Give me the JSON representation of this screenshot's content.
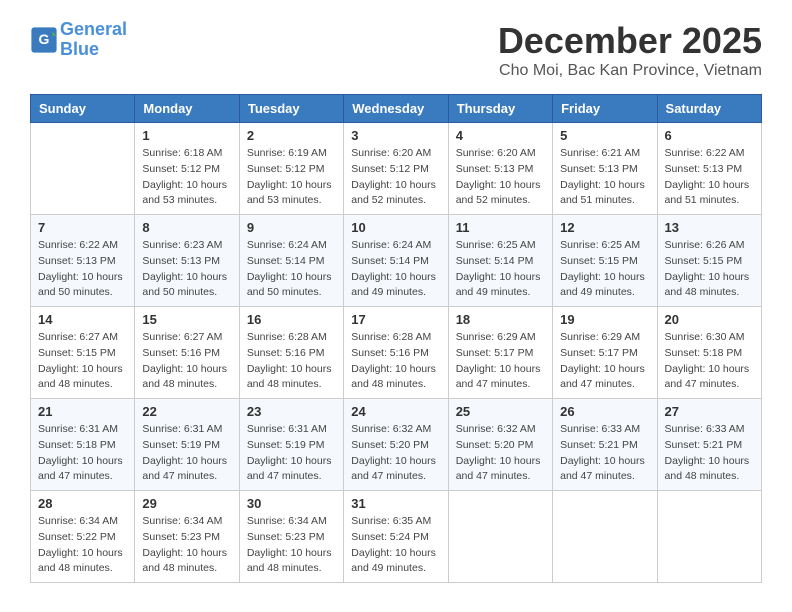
{
  "header": {
    "logo_line1": "General",
    "logo_line2": "Blue",
    "title": "December 2025",
    "subtitle": "Cho Moi, Bac Kan Province, Vietnam"
  },
  "weekdays": [
    "Sunday",
    "Monday",
    "Tuesday",
    "Wednesday",
    "Thursday",
    "Friday",
    "Saturday"
  ],
  "weeks": [
    [
      {
        "day": "",
        "info": ""
      },
      {
        "day": "1",
        "info": "Sunrise: 6:18 AM\nSunset: 5:12 PM\nDaylight: 10 hours\nand 53 minutes."
      },
      {
        "day": "2",
        "info": "Sunrise: 6:19 AM\nSunset: 5:12 PM\nDaylight: 10 hours\nand 53 minutes."
      },
      {
        "day": "3",
        "info": "Sunrise: 6:20 AM\nSunset: 5:12 PM\nDaylight: 10 hours\nand 52 minutes."
      },
      {
        "day": "4",
        "info": "Sunrise: 6:20 AM\nSunset: 5:13 PM\nDaylight: 10 hours\nand 52 minutes."
      },
      {
        "day": "5",
        "info": "Sunrise: 6:21 AM\nSunset: 5:13 PM\nDaylight: 10 hours\nand 51 minutes."
      },
      {
        "day": "6",
        "info": "Sunrise: 6:22 AM\nSunset: 5:13 PM\nDaylight: 10 hours\nand 51 minutes."
      }
    ],
    [
      {
        "day": "7",
        "info": "Sunrise: 6:22 AM\nSunset: 5:13 PM\nDaylight: 10 hours\nand 50 minutes."
      },
      {
        "day": "8",
        "info": "Sunrise: 6:23 AM\nSunset: 5:13 PM\nDaylight: 10 hours\nand 50 minutes."
      },
      {
        "day": "9",
        "info": "Sunrise: 6:24 AM\nSunset: 5:14 PM\nDaylight: 10 hours\nand 50 minutes."
      },
      {
        "day": "10",
        "info": "Sunrise: 6:24 AM\nSunset: 5:14 PM\nDaylight: 10 hours\nand 49 minutes."
      },
      {
        "day": "11",
        "info": "Sunrise: 6:25 AM\nSunset: 5:14 PM\nDaylight: 10 hours\nand 49 minutes."
      },
      {
        "day": "12",
        "info": "Sunrise: 6:25 AM\nSunset: 5:15 PM\nDaylight: 10 hours\nand 49 minutes."
      },
      {
        "day": "13",
        "info": "Sunrise: 6:26 AM\nSunset: 5:15 PM\nDaylight: 10 hours\nand 48 minutes."
      }
    ],
    [
      {
        "day": "14",
        "info": "Sunrise: 6:27 AM\nSunset: 5:15 PM\nDaylight: 10 hours\nand 48 minutes."
      },
      {
        "day": "15",
        "info": "Sunrise: 6:27 AM\nSunset: 5:16 PM\nDaylight: 10 hours\nand 48 minutes."
      },
      {
        "day": "16",
        "info": "Sunrise: 6:28 AM\nSunset: 5:16 PM\nDaylight: 10 hours\nand 48 minutes."
      },
      {
        "day": "17",
        "info": "Sunrise: 6:28 AM\nSunset: 5:16 PM\nDaylight: 10 hours\nand 48 minutes."
      },
      {
        "day": "18",
        "info": "Sunrise: 6:29 AM\nSunset: 5:17 PM\nDaylight: 10 hours\nand 47 minutes."
      },
      {
        "day": "19",
        "info": "Sunrise: 6:29 AM\nSunset: 5:17 PM\nDaylight: 10 hours\nand 47 minutes."
      },
      {
        "day": "20",
        "info": "Sunrise: 6:30 AM\nSunset: 5:18 PM\nDaylight: 10 hours\nand 47 minutes."
      }
    ],
    [
      {
        "day": "21",
        "info": "Sunrise: 6:31 AM\nSunset: 5:18 PM\nDaylight: 10 hours\nand 47 minutes."
      },
      {
        "day": "22",
        "info": "Sunrise: 6:31 AM\nSunset: 5:19 PM\nDaylight: 10 hours\nand 47 minutes."
      },
      {
        "day": "23",
        "info": "Sunrise: 6:31 AM\nSunset: 5:19 PM\nDaylight: 10 hours\nand 47 minutes."
      },
      {
        "day": "24",
        "info": "Sunrise: 6:32 AM\nSunset: 5:20 PM\nDaylight: 10 hours\nand 47 minutes."
      },
      {
        "day": "25",
        "info": "Sunrise: 6:32 AM\nSunset: 5:20 PM\nDaylight: 10 hours\nand 47 minutes."
      },
      {
        "day": "26",
        "info": "Sunrise: 6:33 AM\nSunset: 5:21 PM\nDaylight: 10 hours\nand 47 minutes."
      },
      {
        "day": "27",
        "info": "Sunrise: 6:33 AM\nSunset: 5:21 PM\nDaylight: 10 hours\nand 48 minutes."
      }
    ],
    [
      {
        "day": "28",
        "info": "Sunrise: 6:34 AM\nSunset: 5:22 PM\nDaylight: 10 hours\nand 48 minutes."
      },
      {
        "day": "29",
        "info": "Sunrise: 6:34 AM\nSunset: 5:23 PM\nDaylight: 10 hours\nand 48 minutes."
      },
      {
        "day": "30",
        "info": "Sunrise: 6:34 AM\nSunset: 5:23 PM\nDaylight: 10 hours\nand 48 minutes."
      },
      {
        "day": "31",
        "info": "Sunrise: 6:35 AM\nSunset: 5:24 PM\nDaylight: 10 hours\nand 49 minutes."
      },
      {
        "day": "",
        "info": ""
      },
      {
        "day": "",
        "info": ""
      },
      {
        "day": "",
        "info": ""
      }
    ]
  ]
}
